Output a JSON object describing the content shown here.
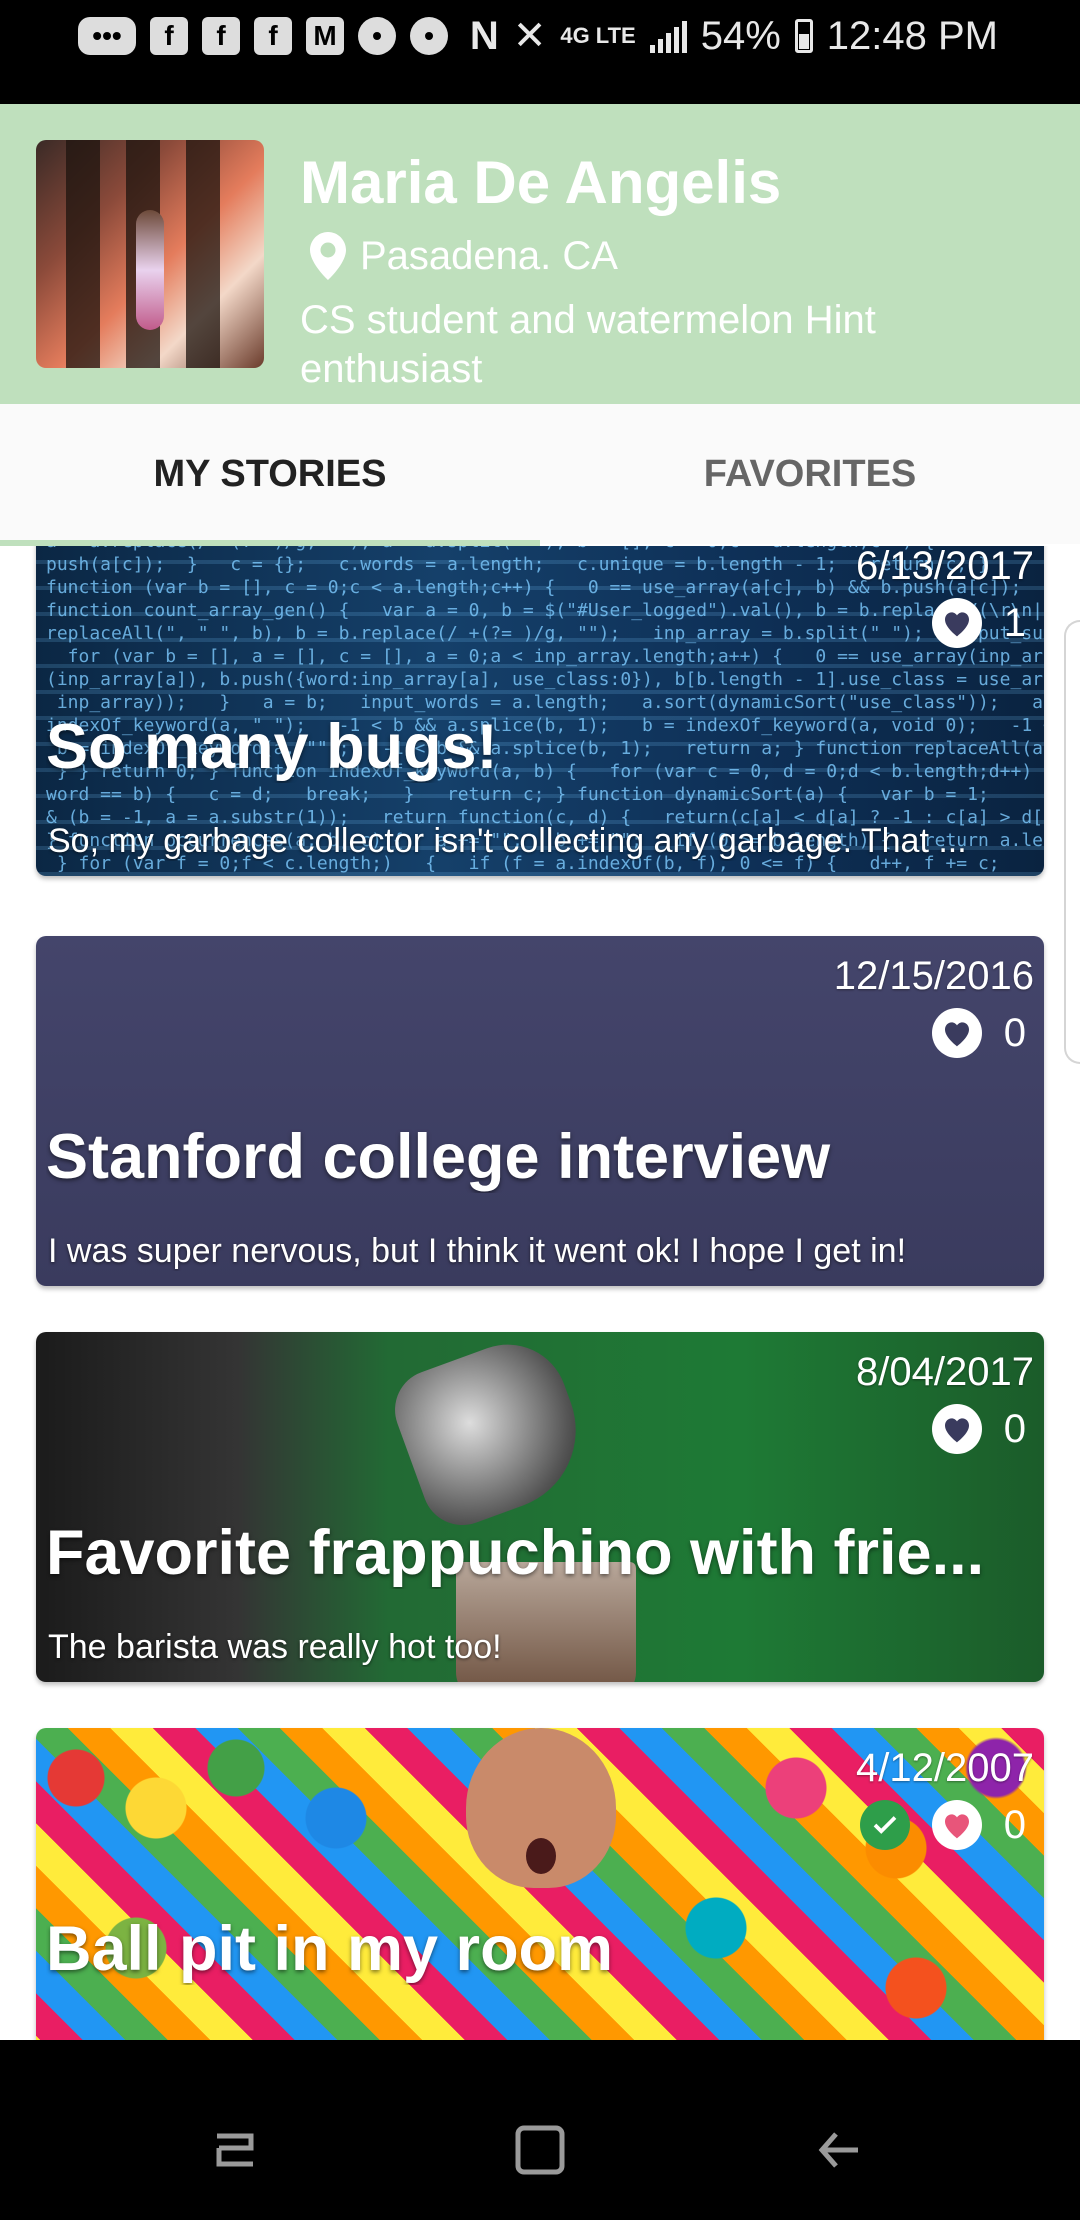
{
  "status_bar": {
    "battery_percent": "54%",
    "time": "12:48 PM",
    "network": "4G LTE",
    "left_icons": [
      "messages-icon",
      "facebook-icon",
      "facebook-icon",
      "facebook-icon",
      "gmail-icon",
      "notification-icon",
      "notification-icon"
    ],
    "right_icons": [
      "nfc-icon",
      "vibrate-icon",
      "network-4g-icon",
      "signal-icon",
      "battery-icon"
    ]
  },
  "profile": {
    "name": "Maria De Angelis",
    "location": "Pasadena. CA",
    "bio": "CS student and watermelon Hint enthusiast",
    "header_color": "#bfe0bd"
  },
  "tabs": [
    {
      "label": "MY STORIES",
      "active": true
    },
    {
      "label": "FAVORITES",
      "active": false
    }
  ],
  "stories": [
    {
      "date": "6/13/2017",
      "likes": "1",
      "title": "So many bugs!",
      "description": "So, my garbage collector isn't collecting any garbage. That ...",
      "background": "code"
    },
    {
      "date": "12/15/2016",
      "likes": "0",
      "title": "Stanford college interview",
      "description": "I was super nervous, but I think it went ok! I hope I get in!",
      "background": "purple"
    },
    {
      "date": "8/04/2017",
      "likes": "0",
      "title": "Favorite frappuchino with frie...",
      "description": "The barista was really hot too!",
      "background": "coffee"
    },
    {
      "date": "4/12/2007",
      "likes": "0",
      "title": "Ball pit in my room",
      "description": "",
      "background": "balls",
      "checked": true
    }
  ],
  "nav_bar": {
    "buttons": [
      "recent-apps-icon",
      "home-icon",
      "back-icon"
    ]
  }
}
